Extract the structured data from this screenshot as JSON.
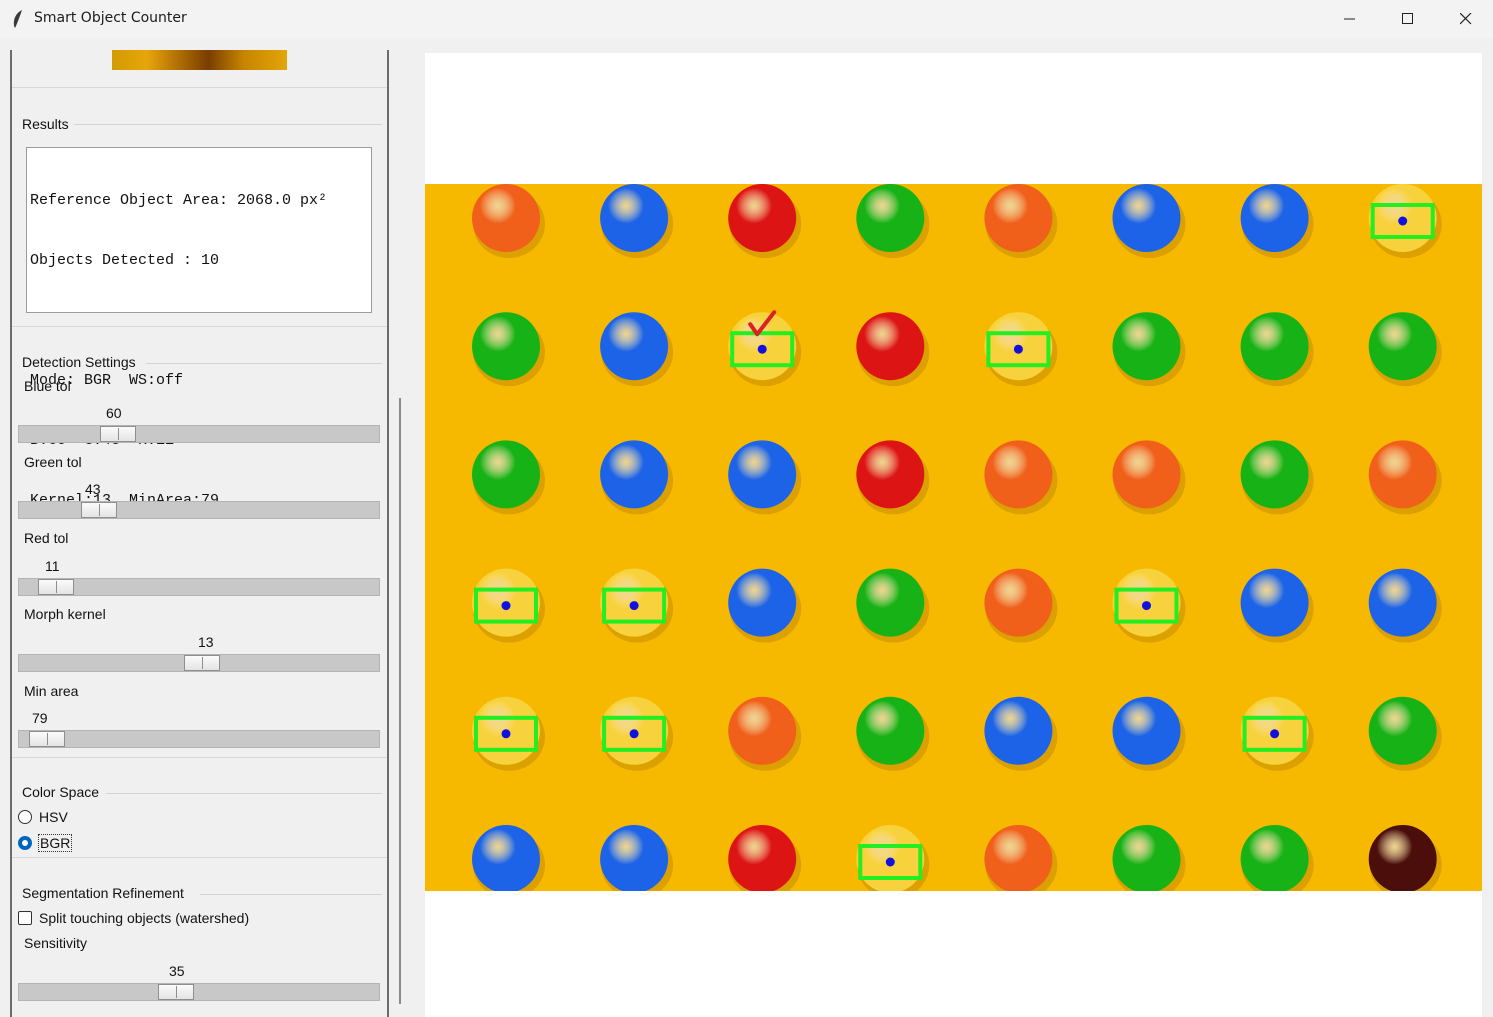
{
  "window": {
    "title": "Smart Object Counter",
    "minimize_icon": "minimize-icon",
    "maximize_icon": "maximize-icon",
    "close_icon": "close-icon"
  },
  "results": {
    "label": "Results",
    "lines": [
      "Reference Object Area: 2068.0 px²",
      "Objects Detected : 10",
      "",
      "Mode: BGR  WS:off",
      "B:60  G:43  R:11",
      "Kernel:13  MinArea:79"
    ]
  },
  "detection": {
    "label": "Detection Settings",
    "sliders": [
      {
        "label": "Blue tol",
        "value": "60",
        "fraction": 0.25
      },
      {
        "label": "Green tol",
        "value": "43",
        "fraction": 0.19
      },
      {
        "label": "Red tol",
        "value": "11",
        "fraction": 0.06
      },
      {
        "label": "Morph kernel",
        "value": "13",
        "fraction": 0.51
      },
      {
        "label": "Min area",
        "value": "79",
        "fraction": 0.03
      }
    ]
  },
  "color_space": {
    "label": "Color Space",
    "options": [
      "HSV",
      "BGR"
    ],
    "selected": "BGR"
  },
  "segmentation": {
    "label": "Segmentation Refinement",
    "checkbox_label": "Split touching objects (watershed)",
    "checked": false,
    "sensitivity_label": "Sensitivity",
    "sensitivity_value": "35",
    "sensitivity_fraction": 0.43
  },
  "image": {
    "background_color": "#f7b900",
    "grid_rows": [
      [
        "orange",
        "blue",
        "red",
        "green",
        "orange",
        "blue",
        "blue",
        "yellow"
      ],
      [
        "green",
        "blue",
        "yellow",
        "red",
        "yellow",
        "green",
        "green",
        "green"
      ],
      [
        "green",
        "blue",
        "blue",
        "red",
        "orange",
        "orange",
        "green",
        "orange"
      ],
      [
        "yellow",
        "yellow",
        "blue",
        "green",
        "orange",
        "yellow",
        "blue",
        "blue"
      ],
      [
        "yellow",
        "yellow",
        "orange",
        "green",
        "blue",
        "blue",
        "yellow",
        "green"
      ],
      [
        "blue",
        "blue",
        "red",
        "yellow",
        "orange",
        "green",
        "green",
        "brown"
      ]
    ],
    "detected": [
      [
        0,
        7
      ],
      [
        1,
        2
      ],
      [
        1,
        4
      ],
      [
        3,
        0
      ],
      [
        3,
        1
      ],
      [
        3,
        5
      ],
      [
        4,
        0
      ],
      [
        4,
        1
      ],
      [
        4,
        6
      ],
      [
        5,
        3
      ]
    ],
    "reference": [
      1,
      2
    ],
    "colors": {
      "orange": "#f0601a",
      "blue": "#1c63e8",
      "red": "#dd1414",
      "green": "#16b216",
      "yellow": "#f8d23c",
      "brown": "#4b0e0a",
      "box": "#22ee22",
      "center": "#1010e0",
      "check": "#dd2020"
    }
  }
}
